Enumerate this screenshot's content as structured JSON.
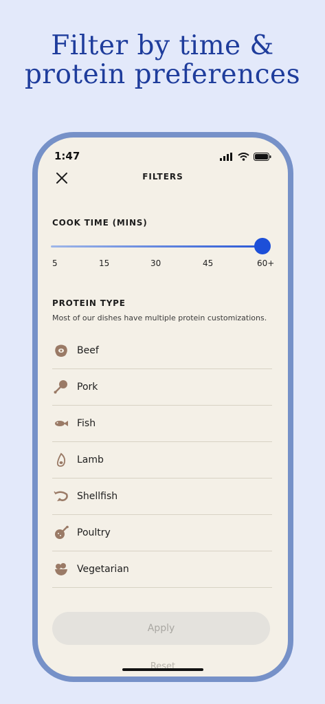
{
  "headline": {
    "line1": "Filter by time &",
    "line2": "protein preferences"
  },
  "status_bar": {
    "time": "1:47"
  },
  "header": {
    "title": "FILTERS",
    "close_icon": "close-icon"
  },
  "cook_time": {
    "title": "COOK TIME (MINS)",
    "ticks": [
      "5",
      "15",
      "30",
      "45",
      "60+"
    ],
    "selected": "60+"
  },
  "protein": {
    "title": "PROTEIN TYPE",
    "subtitle": "Most of our dishes have multiple protein customizations.",
    "items": [
      {
        "label": "Beef",
        "icon": "beef-icon"
      },
      {
        "label": "Pork",
        "icon": "pork-icon"
      },
      {
        "label": "Fish",
        "icon": "fish-icon"
      },
      {
        "label": "Lamb",
        "icon": "lamb-icon"
      },
      {
        "label": "Shellfish",
        "icon": "shellfish-icon"
      },
      {
        "label": "Poultry",
        "icon": "poultry-icon"
      },
      {
        "label": "Vegetarian",
        "icon": "vegetarian-icon"
      }
    ]
  },
  "actions": {
    "apply": "Apply",
    "reset": "Reset"
  },
  "colors": {
    "accent": "#1d4fd8",
    "headline": "#1f3d9c",
    "phone_frame": "#7691c8",
    "screen_bg": "#f4f0e7",
    "icon": "#9a7a66"
  }
}
